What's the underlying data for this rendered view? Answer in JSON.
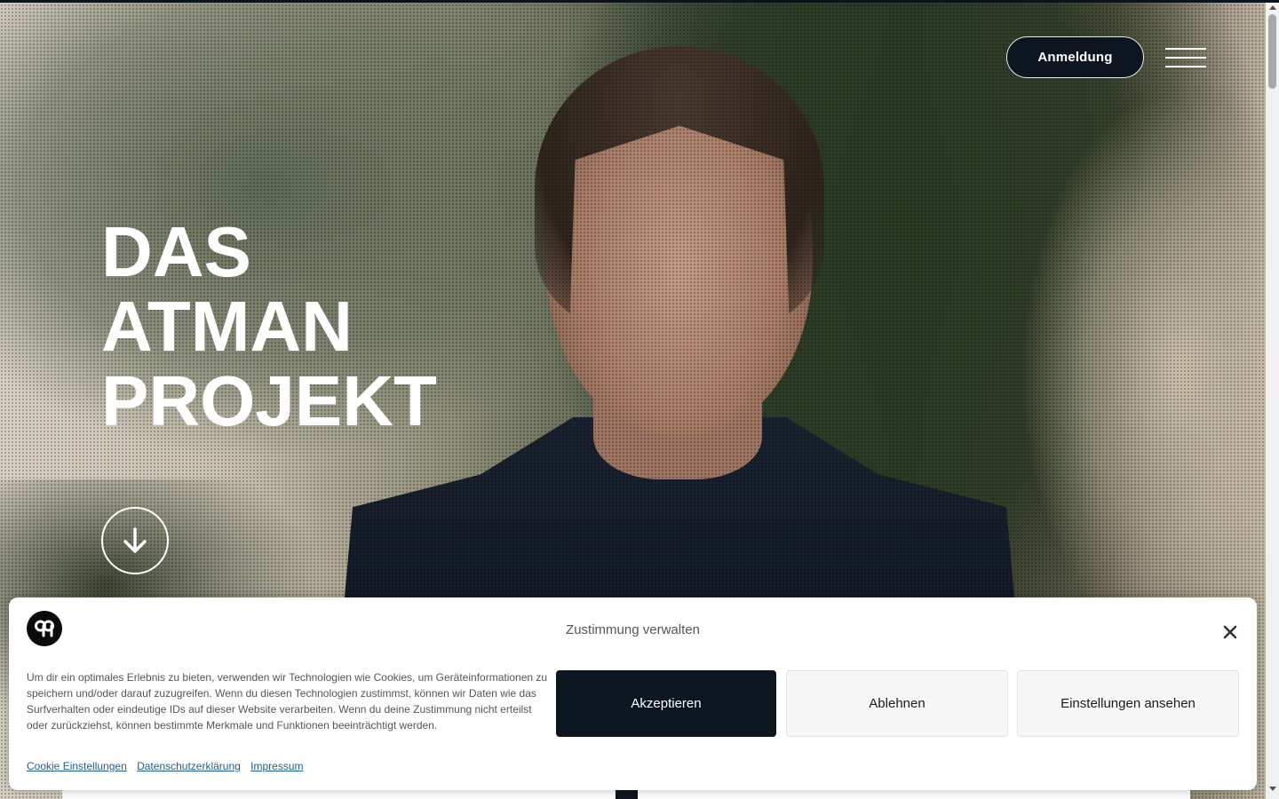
{
  "header": {
    "login_label": "Anmeldung",
    "menu_icon": "hamburger-menu-icon"
  },
  "hero": {
    "title_lines": [
      "DAS",
      "ATMAN",
      "PROJEKT"
    ],
    "scroll_icon": "arrow-down-icon"
  },
  "cookie_banner": {
    "logo_icon": "brand-logo-icon",
    "title": "Zustimmung verwalten",
    "close_icon": "close-icon",
    "message": "Um dir ein optimales Erlebnis zu bieten, verwenden wir Technologien wie Cookies, um Geräteinformationen zu speichern und/oder darauf zuzugreifen. Wenn du diesen Technologien zustimmst, können wir Daten wie das Surfverhalten oder eindeutige IDs auf dieser Website verarbeiten. Wenn du deine Zustimmung nicht erteilst oder zurückziehst, können bestimmte Merkmale und Funktionen beeinträchtigt werden.",
    "accept_label": "Akzeptieren",
    "deny_label": "Ablehnen",
    "preferences_label": "Einstellungen ansehen",
    "links": {
      "cookie_settings": "Cookie Einstellungen",
      "privacy": "Datenschutzerklärung",
      "imprint": "Impressum"
    }
  },
  "colors": {
    "dark_navy": "#0d1620",
    "white": "#ffffff",
    "link_blue": "#1f5f8f",
    "secondary_button_bg": "#f7f7f7"
  }
}
